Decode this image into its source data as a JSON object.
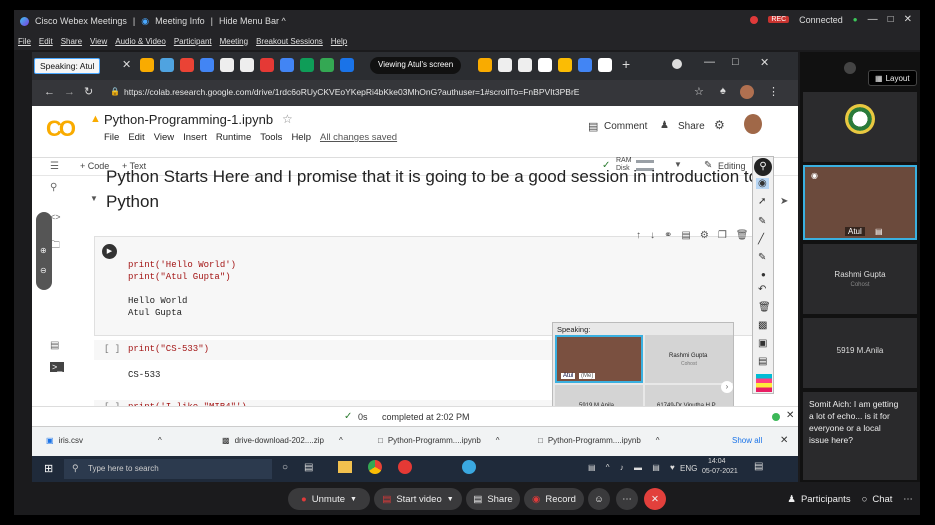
{
  "webex": {
    "title_app": "Cisco Webex Meetings",
    "title_info": "Meeting Info",
    "title_hide": "Hide Menu Bar ^",
    "menu": [
      "File",
      "Edit",
      "Share",
      "View",
      "Audio & Video",
      "Participant",
      "Meeting",
      "Breakout Sessions",
      "Help"
    ],
    "connected": "Connected",
    "rec_badge": "●"
  },
  "banner": {
    "speaking": "Speaking: Atul",
    "viewing": "Viewing Atul's screen"
  },
  "browser": {
    "url": "https://colab.research.google.com/drive/1rdc6oRUyCKVEoYKepRi4bKke03MhOnG?authuser=1#scrollTo=FnBPVIt3PBrE"
  },
  "colab": {
    "title": "Python-Programming-1.ipynb",
    "menu": [
      "File",
      "Edit",
      "View",
      "Insert",
      "Runtime",
      "Tools",
      "Help"
    ],
    "saved": "All changes saved",
    "comment": "Comment",
    "share": "Share",
    "add_code": "+ Code",
    "add_text": "+ Text",
    "ram": "RAM",
    "disk": "Disk",
    "editing": "Editing",
    "heading_partial": "Python Starts Here and I promise that it is going to be a good session in introduction to",
    "heading_line2": "Python",
    "cell1_code_1": "print('Hello World')",
    "cell1_code_2": "print(\"Atul Gupta\")",
    "cell1_out_1": "Hello World",
    "cell1_out_2": "Atul Gupta",
    "cell2_prompt": "[ ]",
    "cell2_code": "print(\"CS-533\")",
    "cell2_out": "CS-533",
    "cell3_prompt": "[ ]",
    "cell3_code": "print('I like \"MIB4\"')",
    "status_time": "0s",
    "status_text": "completed at 2:02 PM"
  },
  "downloads": {
    "items": [
      "iris.csv",
      "drive-download-202....zip",
      "Python-Programm....ipynb",
      "Python-Programm....ipynb"
    ],
    "show_all": "Show all"
  },
  "taskbar": {
    "search": "Type here to search",
    "lang": "ENG",
    "time": "14:04",
    "date": "05-07-2021"
  },
  "popup": {
    "speaking": "Speaking:",
    "p1_name": "Atul",
    "p1_sub": "(Me)",
    "p2_name": "Rashmi Gupta",
    "p2_sub": "Cohost",
    "p3_name": "5919 M.Anila",
    "p4_name": "61749-Dr Vinutha H P"
  },
  "panel": {
    "layout": "Layout",
    "atul": "Atul",
    "rashmi": "Rashmi Gupta",
    "rashmi_sub": "Cohost",
    "anila": "5919 M.Anila",
    "chat_msg": "Somit Aich: I am getting a lot of echo... is it for everyone or a local issue here?"
  },
  "controls": {
    "unmute": "Unmute",
    "start_video": "Start video",
    "share": "Share",
    "record": "Record",
    "participants": "Participants",
    "chat": "Chat"
  },
  "colors": {
    "webex_bg": "#1b1b1d",
    "accent_blue": "#3a8dde",
    "record_red": "#e03a3a",
    "colab_orange": "#f9ab00",
    "end_red": "#e2403c"
  }
}
